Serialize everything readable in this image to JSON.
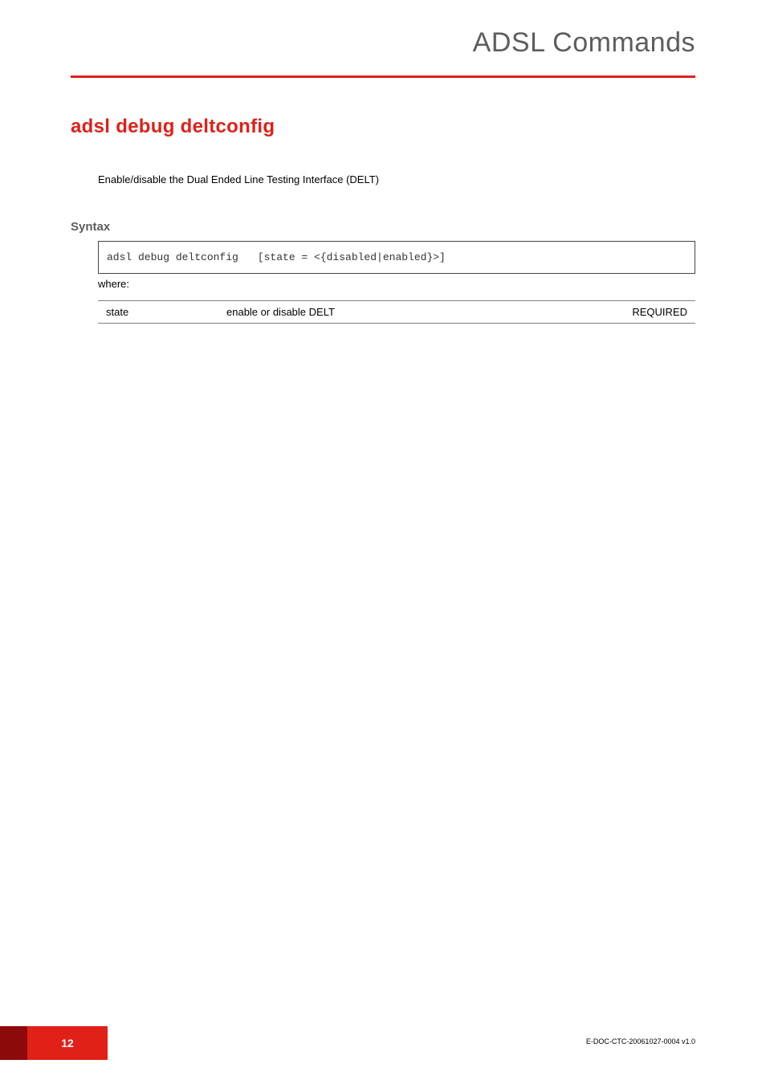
{
  "header": {
    "title": "ADSL Commands"
  },
  "command": {
    "title": "adsl debug deltconfig",
    "description": "Enable/disable the Dual Ended Line Testing Interface (DELT)"
  },
  "syntax": {
    "label": "Syntax",
    "cmd": "adsl debug deltconfig",
    "args": "[state = <{disabled|enabled}>]",
    "where": "where:"
  },
  "params": [
    {
      "name": "state",
      "desc": "enable or disable DELT",
      "req": "REQUIRED"
    }
  ],
  "footer": {
    "page": "12",
    "docid": "E-DOC-CTC-20061027-0004 v1.0"
  }
}
